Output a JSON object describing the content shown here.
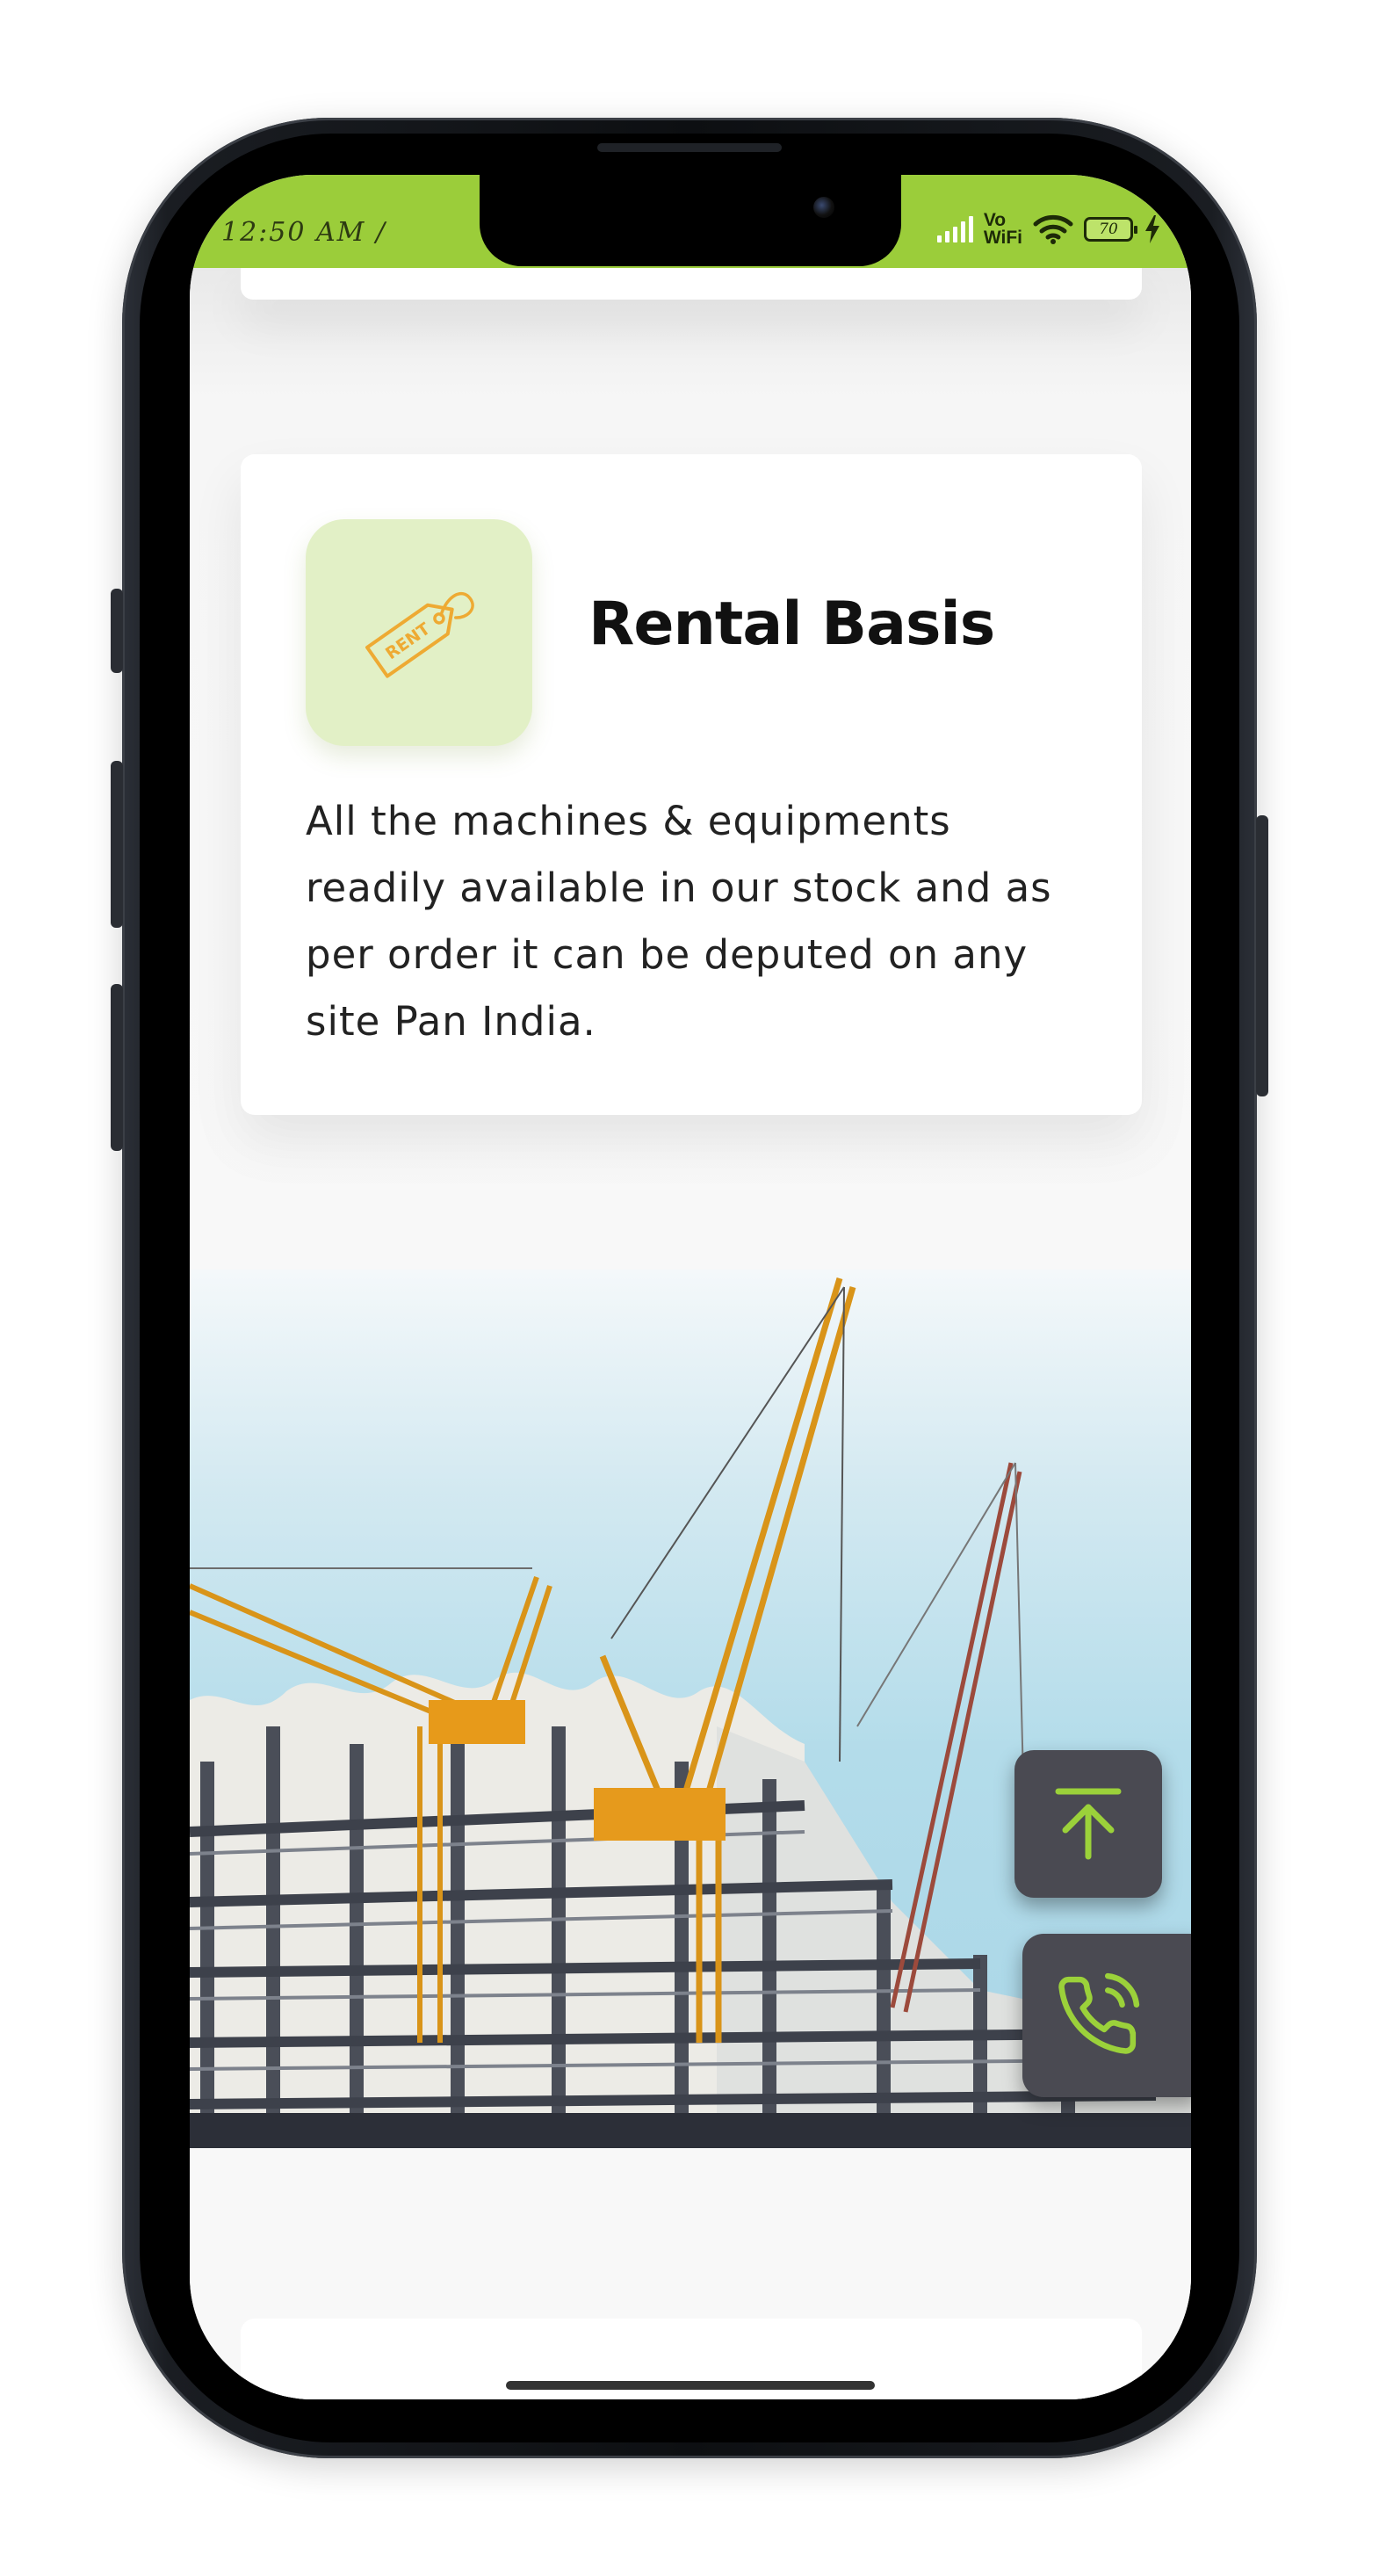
{
  "status_bar": {
    "time": "12:50 AM /",
    "network_label_top": "Vo",
    "network_label_bottom": "WiFi",
    "battery_level": "70",
    "icons": [
      "signal-icon",
      "wifi-icon",
      "battery-icon",
      "charging-icon"
    ]
  },
  "service_card": {
    "icon": "rent-tag-icon",
    "icon_text": "RENT",
    "title": "Rental Basis",
    "description": "All the machines & equipments readily available in our stock and as per order it can be deputed on any site Pan India."
  },
  "hero": {
    "image": "construction-cranes-image"
  },
  "floating_buttons": {
    "scroll_top_icon": "arrow-up-icon",
    "call_icon": "phone-call-icon"
  },
  "colors": {
    "accent": "#9bcd3a",
    "icon_tile": "#e2f0c6",
    "tag_orange": "#eeaa33",
    "fab_background": "#4a4a52",
    "fab_icon": "#9bd13a"
  }
}
